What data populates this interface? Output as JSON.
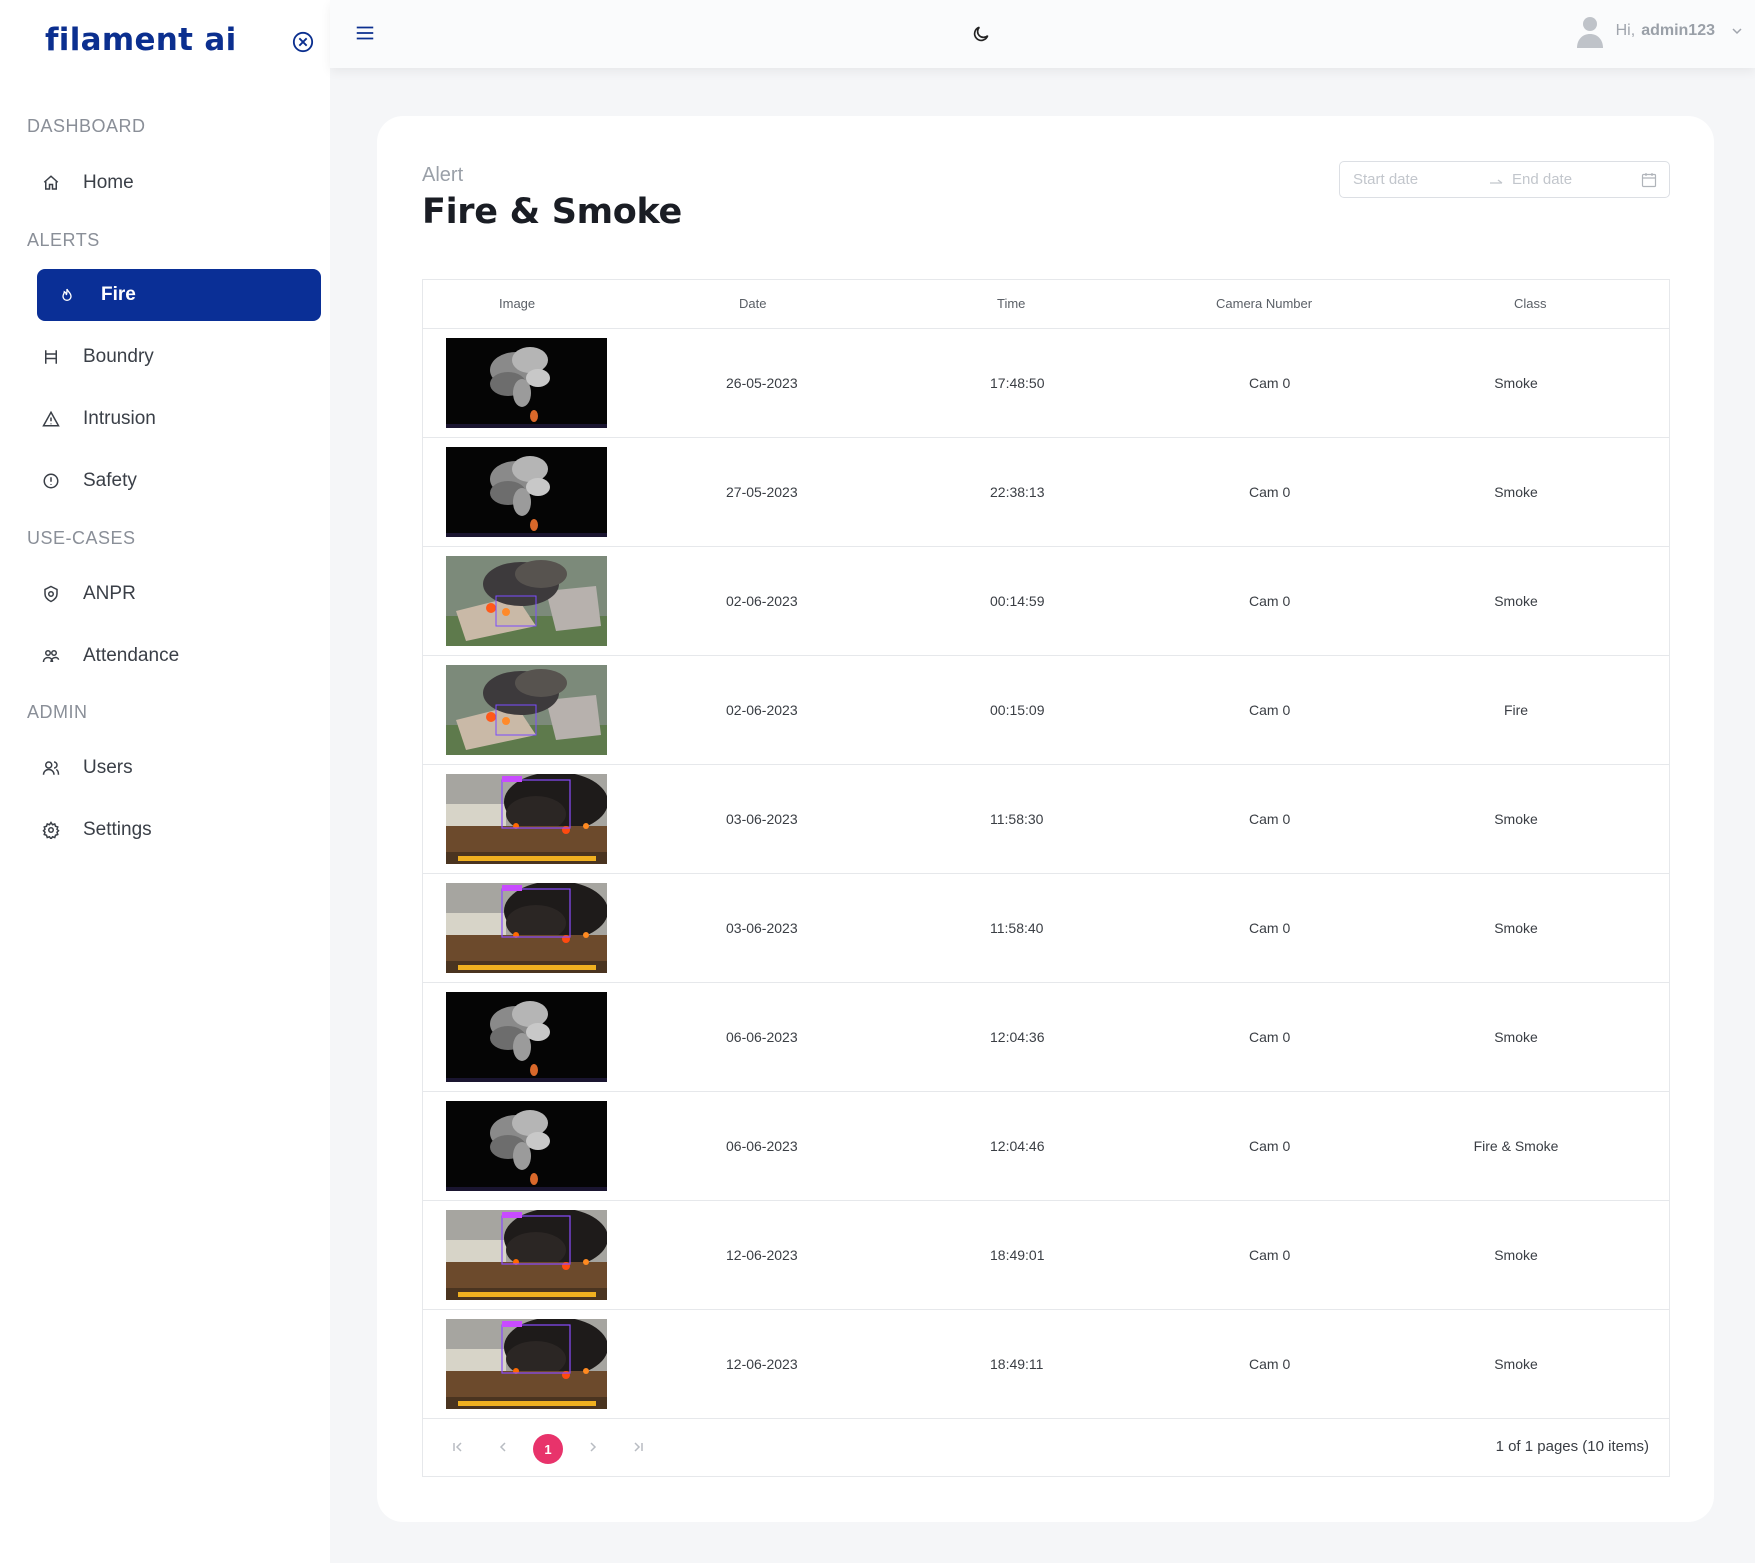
{
  "app": {
    "logo": "filament ai"
  },
  "sidebar": {
    "sections": [
      {
        "label": "DASHBOARD"
      },
      {
        "label": "ALERTS"
      },
      {
        "label": "USE-CASES"
      },
      {
        "label": "ADMIN"
      }
    ],
    "items": [
      {
        "label": "Home",
        "icon": "home-icon"
      },
      {
        "label": "Fire",
        "icon": "flame-icon",
        "active": true
      },
      {
        "label": "Boundry",
        "icon": "barrier-icon"
      },
      {
        "label": "Intrusion",
        "icon": "warning-icon"
      },
      {
        "label": "Safety",
        "icon": "info-circle-icon"
      },
      {
        "label": "ANPR",
        "icon": "shield-icon"
      },
      {
        "label": "Attendance",
        "icon": "group-icon"
      },
      {
        "label": "Users",
        "icon": "users-icon"
      },
      {
        "label": "Settings",
        "icon": "gear-icon"
      }
    ]
  },
  "topbar": {
    "greeting": "Hi,",
    "username": "admin123"
  },
  "page": {
    "subtitle": "Alert",
    "title": "Fire & Smoke",
    "date_start_placeholder": "Start date",
    "date_end_placeholder": "End date"
  },
  "table": {
    "columns": [
      "Image",
      "Date",
      "Time",
      "Camera Number",
      "Class"
    ],
    "rows": [
      {
        "image": "smoke-dark",
        "date": "26-05-2023",
        "time": "17:48:50",
        "camera": "Cam 0",
        "class": "Smoke"
      },
      {
        "image": "smoke-dark",
        "date": "27-05-2023",
        "time": "22:38:13",
        "camera": "Cam 0",
        "class": "Smoke"
      },
      {
        "image": "aerial-fire",
        "date": "02-06-2023",
        "time": "00:14:59",
        "camera": "Cam 0",
        "class": "Smoke"
      },
      {
        "image": "aerial-fire",
        "date": "02-06-2023",
        "time": "00:15:09",
        "camera": "Cam 0",
        "class": "Fire"
      },
      {
        "image": "field-fire",
        "date": "03-06-2023",
        "time": "11:58:30",
        "camera": "Cam 0",
        "class": "Smoke"
      },
      {
        "image": "field-fire",
        "date": "03-06-2023",
        "time": "11:58:40",
        "camera": "Cam 0",
        "class": "Smoke"
      },
      {
        "image": "smoke-dark",
        "date": "06-06-2023",
        "time": "12:04:36",
        "camera": "Cam 0",
        "class": "Smoke"
      },
      {
        "image": "smoke-dark",
        "date": "06-06-2023",
        "time": "12:04:46",
        "camera": "Cam 0",
        "class": "Fire & Smoke"
      },
      {
        "image": "field-fire",
        "date": "12-06-2023",
        "time": "18:49:01",
        "camera": "Cam 0",
        "class": "Smoke"
      },
      {
        "image": "field-fire",
        "date": "12-06-2023",
        "time": "18:49:11",
        "camera": "Cam 0",
        "class": "Smoke"
      }
    ]
  },
  "pager": {
    "current": "1",
    "info": "1 of 1 pages (10 items)"
  },
  "colors": {
    "brand": "#0a2f96",
    "page_active": "#e8336b"
  }
}
